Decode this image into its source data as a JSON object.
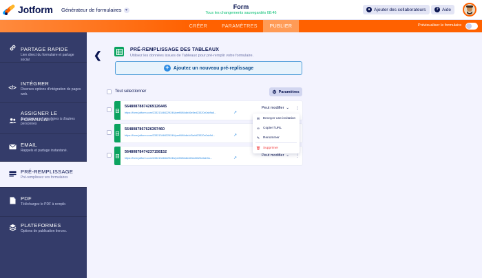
{
  "header": {
    "logo_text": "Jotform",
    "builder_label": "Générateur de formulaires",
    "form_title": "Form",
    "save_status": "Tous les changements sauvegardés 08:46",
    "collab_label": "Ajouter des collaborateurs",
    "help_label": "Aide"
  },
  "nav": {
    "tabs": [
      {
        "label": "CRÉER"
      },
      {
        "label": "PARAMÈTRES"
      },
      {
        "label": "PUBLIER"
      }
    ],
    "preview_label": "Prévisualiser le formulaire"
  },
  "sidebar": {
    "items": [
      {
        "title": "PARTAGE RAPIDE",
        "desc": "Lien direct du formulaire et partage social"
      },
      {
        "title": "INTÉGRER",
        "desc": "Diverses options d'intégration de pages web."
      },
      {
        "title": "ASSIGNER LE FORMULAI...",
        "desc": "Assignez vos formulaires à d'autres personnes"
      },
      {
        "title": "EMAIL",
        "desc": "Rappels et partage instantané."
      },
      {
        "title": "PRÉ-REMPLISSAGE",
        "desc": "Pré-remplissez vos formulaires"
      },
      {
        "title": "PDF",
        "desc": "Téléchargez le PDF à remplir."
      },
      {
        "title": "PLATEFORMES",
        "desc": "Options de publication tierces."
      }
    ]
  },
  "main": {
    "title": "PRÉ-REMPLISSAGE DES TABLEAUX",
    "subtitle": "Utilisez les données issues de Tableaux pour pré-remplir votre formulaire.",
    "add_button": "Ajoutez un nouveau pré-replissage",
    "select_all": "Tout sélectionner",
    "params_button": "Paramètres",
    "rows": [
      {
        "id": "56480878874269126445",
        "link": "https://form.jotform.com/233213484229246/prefill/64db46e5ed23320c0ab9a6...",
        "perm": "Peut modifier"
      },
      {
        "id": "5648087867626397460",
        "link": "https://form.jotform.com/233213484229246/prefill/64db4d3a4d23320c0ab9d...",
        "perm": "Peut modifier"
      },
      {
        "id": "56480878474237158152",
        "link": "https://form.jotform.com/233213484229246/prefill/64db463ed3320c0ab9a...",
        "perm": "Peut modifier"
      }
    ]
  },
  "context_menu": {
    "items": [
      {
        "label": "Envoyer une invitation",
        "icon": "mail-icon"
      },
      {
        "label": "Copier l'URL",
        "icon": "link-icon"
      },
      {
        "label": "Renommer",
        "icon": "pencil-icon"
      },
      {
        "label": "Supprimer",
        "icon": "trash-icon"
      }
    ]
  },
  "colors": {
    "accent": "#ff6100",
    "sidebar": "#343c6a",
    "sheet_green": "#0ba360",
    "link_blue": "#2d8ce3",
    "danger": "#f23a3c"
  }
}
